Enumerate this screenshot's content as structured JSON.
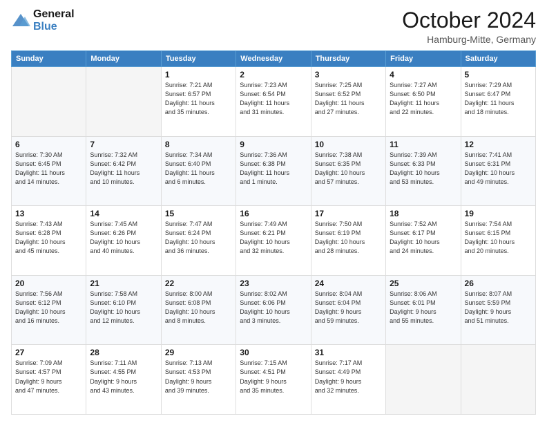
{
  "logo": {
    "line1": "General",
    "line2": "Blue"
  },
  "header": {
    "month": "October 2024",
    "location": "Hamburg-Mitte, Germany"
  },
  "weekdays": [
    "Sunday",
    "Monday",
    "Tuesday",
    "Wednesday",
    "Thursday",
    "Friday",
    "Saturday"
  ],
  "weeks": [
    [
      {
        "day": "",
        "info": ""
      },
      {
        "day": "",
        "info": ""
      },
      {
        "day": "1",
        "info": "Sunrise: 7:21 AM\nSunset: 6:57 PM\nDaylight: 11 hours\nand 35 minutes."
      },
      {
        "day": "2",
        "info": "Sunrise: 7:23 AM\nSunset: 6:54 PM\nDaylight: 11 hours\nand 31 minutes."
      },
      {
        "day": "3",
        "info": "Sunrise: 7:25 AM\nSunset: 6:52 PM\nDaylight: 11 hours\nand 27 minutes."
      },
      {
        "day": "4",
        "info": "Sunrise: 7:27 AM\nSunset: 6:50 PM\nDaylight: 11 hours\nand 22 minutes."
      },
      {
        "day": "5",
        "info": "Sunrise: 7:29 AM\nSunset: 6:47 PM\nDaylight: 11 hours\nand 18 minutes."
      }
    ],
    [
      {
        "day": "6",
        "info": "Sunrise: 7:30 AM\nSunset: 6:45 PM\nDaylight: 11 hours\nand 14 minutes."
      },
      {
        "day": "7",
        "info": "Sunrise: 7:32 AM\nSunset: 6:42 PM\nDaylight: 11 hours\nand 10 minutes."
      },
      {
        "day": "8",
        "info": "Sunrise: 7:34 AM\nSunset: 6:40 PM\nDaylight: 11 hours\nand 6 minutes."
      },
      {
        "day": "9",
        "info": "Sunrise: 7:36 AM\nSunset: 6:38 PM\nDaylight: 11 hours\nand 1 minute."
      },
      {
        "day": "10",
        "info": "Sunrise: 7:38 AM\nSunset: 6:35 PM\nDaylight: 10 hours\nand 57 minutes."
      },
      {
        "day": "11",
        "info": "Sunrise: 7:39 AM\nSunset: 6:33 PM\nDaylight: 10 hours\nand 53 minutes."
      },
      {
        "day": "12",
        "info": "Sunrise: 7:41 AM\nSunset: 6:31 PM\nDaylight: 10 hours\nand 49 minutes."
      }
    ],
    [
      {
        "day": "13",
        "info": "Sunrise: 7:43 AM\nSunset: 6:28 PM\nDaylight: 10 hours\nand 45 minutes."
      },
      {
        "day": "14",
        "info": "Sunrise: 7:45 AM\nSunset: 6:26 PM\nDaylight: 10 hours\nand 40 minutes."
      },
      {
        "day": "15",
        "info": "Sunrise: 7:47 AM\nSunset: 6:24 PM\nDaylight: 10 hours\nand 36 minutes."
      },
      {
        "day": "16",
        "info": "Sunrise: 7:49 AM\nSunset: 6:21 PM\nDaylight: 10 hours\nand 32 minutes."
      },
      {
        "day": "17",
        "info": "Sunrise: 7:50 AM\nSunset: 6:19 PM\nDaylight: 10 hours\nand 28 minutes."
      },
      {
        "day": "18",
        "info": "Sunrise: 7:52 AM\nSunset: 6:17 PM\nDaylight: 10 hours\nand 24 minutes."
      },
      {
        "day": "19",
        "info": "Sunrise: 7:54 AM\nSunset: 6:15 PM\nDaylight: 10 hours\nand 20 minutes."
      }
    ],
    [
      {
        "day": "20",
        "info": "Sunrise: 7:56 AM\nSunset: 6:12 PM\nDaylight: 10 hours\nand 16 minutes."
      },
      {
        "day": "21",
        "info": "Sunrise: 7:58 AM\nSunset: 6:10 PM\nDaylight: 10 hours\nand 12 minutes."
      },
      {
        "day": "22",
        "info": "Sunrise: 8:00 AM\nSunset: 6:08 PM\nDaylight: 10 hours\nand 8 minutes."
      },
      {
        "day": "23",
        "info": "Sunrise: 8:02 AM\nSunset: 6:06 PM\nDaylight: 10 hours\nand 3 minutes."
      },
      {
        "day": "24",
        "info": "Sunrise: 8:04 AM\nSunset: 6:04 PM\nDaylight: 9 hours\nand 59 minutes."
      },
      {
        "day": "25",
        "info": "Sunrise: 8:06 AM\nSunset: 6:01 PM\nDaylight: 9 hours\nand 55 minutes."
      },
      {
        "day": "26",
        "info": "Sunrise: 8:07 AM\nSunset: 5:59 PM\nDaylight: 9 hours\nand 51 minutes."
      }
    ],
    [
      {
        "day": "27",
        "info": "Sunrise: 7:09 AM\nSunset: 4:57 PM\nDaylight: 9 hours\nand 47 minutes."
      },
      {
        "day": "28",
        "info": "Sunrise: 7:11 AM\nSunset: 4:55 PM\nDaylight: 9 hours\nand 43 minutes."
      },
      {
        "day": "29",
        "info": "Sunrise: 7:13 AM\nSunset: 4:53 PM\nDaylight: 9 hours\nand 39 minutes."
      },
      {
        "day": "30",
        "info": "Sunrise: 7:15 AM\nSunset: 4:51 PM\nDaylight: 9 hours\nand 35 minutes."
      },
      {
        "day": "31",
        "info": "Sunrise: 7:17 AM\nSunset: 4:49 PM\nDaylight: 9 hours\nand 32 minutes."
      },
      {
        "day": "",
        "info": ""
      },
      {
        "day": "",
        "info": ""
      }
    ]
  ]
}
